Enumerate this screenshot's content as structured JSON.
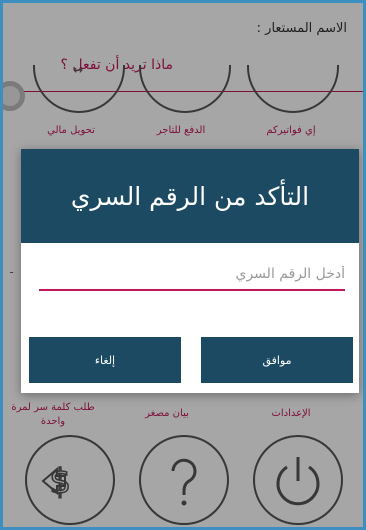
{
  "background": {
    "alias_label": "الاسم المستعار :",
    "subtitle": "ماذا تريد أن تفعل ؟",
    "services": [
      {
        "label": "إي فواتيركم"
      },
      {
        "label": "الدفع للتاجر"
      },
      {
        "label": "تحويل مالي"
      }
    ],
    "bottom_items": [
      {
        "label": "الإعدادات",
        "icon": "power-icon"
      },
      {
        "label": "بيان مصغر",
        "icon": "help-icon"
      },
      {
        "label": "طلب كلمة سر لمرة واحدة",
        "icon": "money-transfer-icon"
      }
    ]
  },
  "dialog": {
    "title": "التأكد من الرقم السري",
    "pin_placeholder": "أدخل الرقم السري",
    "pin_value": "",
    "ok_label": "موافق",
    "cancel_label": "إلغاء"
  },
  "colors": {
    "header": "#1b4a62",
    "accent": "#c2185b",
    "frame": "#3d8fc0"
  }
}
